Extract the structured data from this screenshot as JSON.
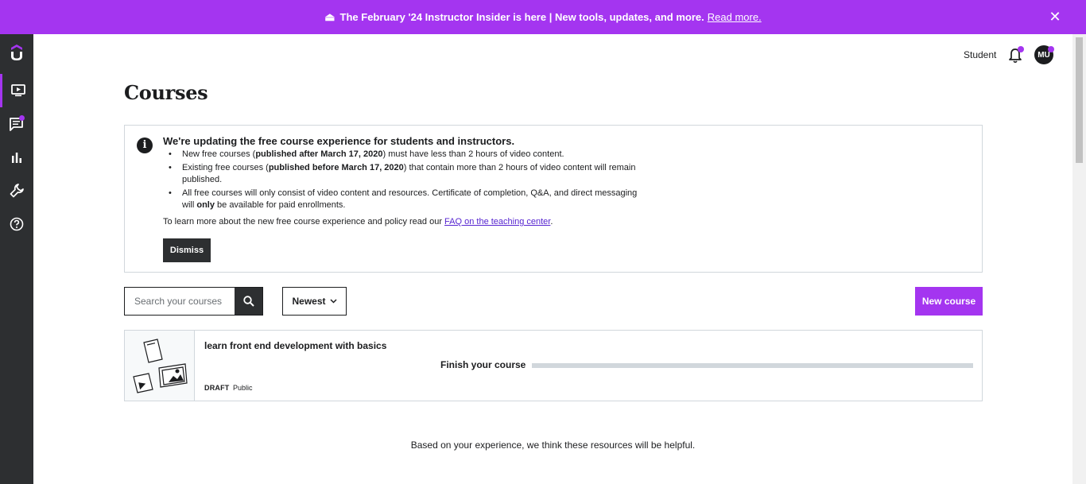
{
  "banner": {
    "text": "The February '24 Instructor Insider is here | New tools, updates, and more.",
    "link": "Read more.",
    "icon": "megaphone-icon",
    "close": "✕",
    "color": "#a435f0"
  },
  "sidebar": {
    "logo": "udemy-logo-icon",
    "items": [
      {
        "name": "courses",
        "icon": "tv-play-icon",
        "active": true
      },
      {
        "name": "communication",
        "icon": "chat-icon",
        "badge": true
      },
      {
        "name": "performance",
        "icon": "bar-chart-icon"
      },
      {
        "name": "tools",
        "icon": "wrench-icon"
      },
      {
        "name": "resources",
        "icon": "help-icon"
      }
    ]
  },
  "header": {
    "student_link": "Student",
    "avatar_initials": "MU"
  },
  "page": {
    "title": "Courses"
  },
  "notice": {
    "heading": "We're updating the free course experience for students and instructors.",
    "bullets": [
      {
        "a": "New free courses (",
        "b": "published after March 17, 2020",
        "c": ") must have less than 2 hours of video content."
      },
      {
        "a": "Existing free courses (",
        "b": "published before March 17, 2020",
        "c": ") that contain more than 2 hours of video content will remain published."
      },
      {
        "a": "All free courses will only consist of video content and resources. Certificate of completion, Q&A, and direct messaging will ",
        "b": "only",
        "c": " be available for paid enrollments."
      }
    ],
    "faq_prefix": "To learn more about the new free course experience and policy read our ",
    "faq_link": "FAQ on the teaching center",
    "faq_suffix": ".",
    "dismiss_label": "Dismiss"
  },
  "controls": {
    "search_placeholder": "Search your courses",
    "sort_label": "Newest",
    "new_course_label": "New course"
  },
  "course": {
    "title": "learn front end development with basics",
    "status": "DRAFT",
    "visibility": "Public",
    "finish_label": "Finish your course",
    "progress": 0
  },
  "footer": {
    "helpful_text": "Based on your experience, we think these resources will be helpful."
  }
}
